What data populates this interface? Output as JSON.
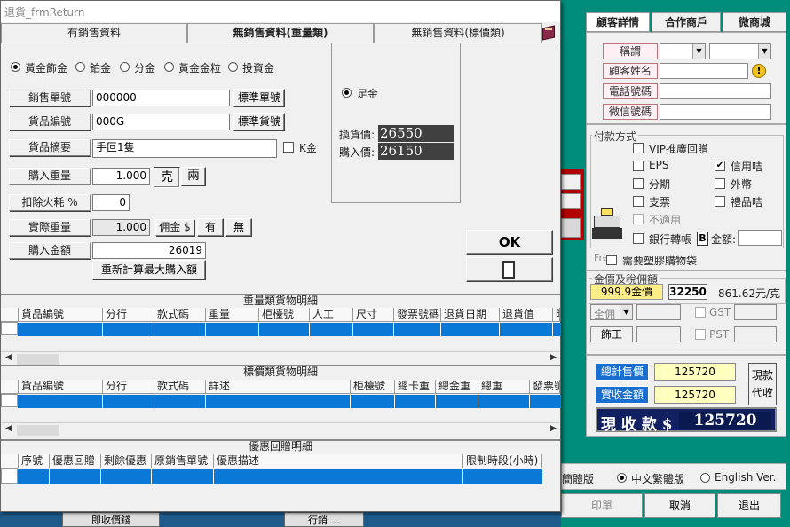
{
  "dialog": {
    "title": "退貨_frmReturn",
    "tabs": [
      "有銷售資料",
      "無銷售資料(重量類)",
      "無銷售資料(標價類)"
    ],
    "metal_types": [
      "黃金飾金",
      "鉑金",
      "分金",
      "黃金金粒",
      "投資金"
    ],
    "fields": {
      "sales_no_label": "銷售單號",
      "sales_no_value": "000000",
      "std_sales_btn": "標準單號",
      "item_code_label": "貨品編號",
      "item_code_value": "000G",
      "std_item_btn": "標準貨號",
      "item_desc_label": "貨品摘要",
      "item_desc_value": "手叵1隻",
      "k_gold_label": "K金",
      "buy_weight_label": "購入重量",
      "buy_weight_value": "1.000",
      "unit_gram": "克",
      "unit_tael": "兩",
      "loss_label": "扣除火耗 %",
      "loss_value": "0",
      "actual_weight_label": "實際重量",
      "actual_weight_value": "1.000",
      "commission_label": "佣金 $",
      "commission_yes": "有",
      "commission_no": "無",
      "buy_amount_label": "購入金額",
      "buy_amount_value": "26019",
      "recalc_btn": "重新計算最大購入額"
    },
    "price_panel": {
      "radio_label": "足金",
      "exchange_label": "換貨價:",
      "exchange_value": "26550",
      "buy_label": "購入價:",
      "buy_value": "26150"
    },
    "ok_btn": "OK",
    "weight_grid": {
      "title": "重量類貨物明細",
      "columns": [
        "貨品編號",
        "分行",
        "款式碼",
        "重量",
        "柜檯號",
        "人工",
        "尺寸",
        "發票號碼",
        "退貨日期",
        "退貨值",
        "時"
      ]
    },
    "price_grid": {
      "title": "標價類貨物明細",
      "columns": [
        "貨品編號",
        "分行",
        "款式碼",
        "詳述",
        "柜檯號",
        "總卡重",
        "總金重",
        "總重",
        "發票號"
      ]
    },
    "discount_grid": {
      "title": "優惠回贈明細",
      "columns": [
        "序號",
        "優惠回贈",
        "剩餘優惠",
        "原銷售單號",
        "優惠描述",
        "限制時段(小時)"
      ]
    }
  },
  "main": {
    "tabs": [
      "顧客詳情",
      "合作商戶",
      "微商城"
    ],
    "customer": {
      "title_label": "稱謂",
      "name_label": "顧客姓名",
      "phone_label": "電話號碼",
      "wechat_label": "微信號碼"
    },
    "payment": {
      "group_label": "付款方式",
      "options": [
        {
          "label": "VIP推廣回贈",
          "checked": false,
          "disabled": false
        },
        {
          "label": "EPS",
          "checked": false,
          "disabled": false
        },
        {
          "label": "信用咭",
          "checked": true,
          "disabled": false
        },
        {
          "label": "分期",
          "checked": false,
          "disabled": false
        },
        {
          "label": "外幣",
          "checked": false,
          "disabled": false
        },
        {
          "label": "支票",
          "checked": false,
          "disabled": false
        },
        {
          "label": "禮品咭",
          "checked": false,
          "disabled": false
        },
        {
          "label": "不適用",
          "checked": false,
          "disabled": true
        },
        {
          "label": "銀行轉帳",
          "checked": false,
          "disabled": false
        }
      ],
      "amount_label": "金額:",
      "bank_b": "B",
      "plastic_bag_label": "需要塑膠購物袋",
      "free_label": "Fre"
    },
    "gold": {
      "group_label": "金價及稅佣額",
      "type_btn": "999.9金價",
      "price_value": "32250",
      "per_gram": "861.62元/克",
      "full_label": "全佣",
      "gst_label": "GST",
      "pst_label": "PST",
      "labor_label": "飾工"
    },
    "totals": {
      "total_label": "總計售價",
      "total_value": "125720",
      "received_label": "實收金額",
      "received_value": "125720",
      "cash_btn": "現款",
      "agent_btn": "代收",
      "cash_label": "現 收 款  $",
      "cash_value": "125720"
    },
    "language": {
      "simplified": "簡體版",
      "traditional": "中文繁體版",
      "english": "English Ver."
    },
    "buttons": {
      "print": "印單",
      "cancel": "取消",
      "exit": "退出"
    },
    "bottom_partial_left": "即收價錢",
    "bottom_partial_mid": "行銷 ..."
  },
  "colors": {
    "teal_bg": "#008c7a",
    "selection_blue": "#0a78d7",
    "price_box": "#404040",
    "total_navy": "#102060"
  }
}
